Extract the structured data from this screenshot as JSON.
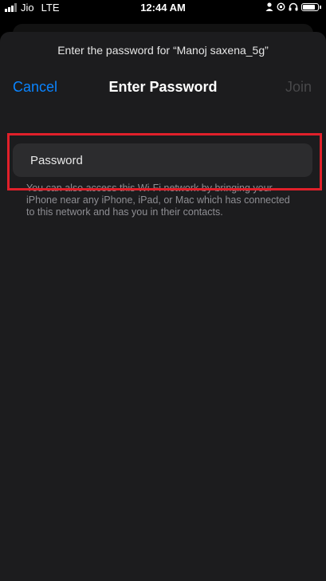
{
  "status_bar": {
    "carrier": "Jio",
    "network": "LTE",
    "time": "12:44 AM"
  },
  "sheet": {
    "prompt": "Enter the password for “Manoj saxena_5g”",
    "cancel_label": "Cancel",
    "title": "Enter Password",
    "join_label": "Join",
    "password_placeholder": "Password",
    "password_value": "",
    "footnote": "You can also access this Wi-Fi network by bringing your iPhone near any iPhone, iPad, or Mac which has connected to this network and has you in their contacts."
  },
  "colors": {
    "accent": "#0a84ff",
    "highlight": "#e0202a",
    "sheet_background": "#1c1c1e"
  }
}
